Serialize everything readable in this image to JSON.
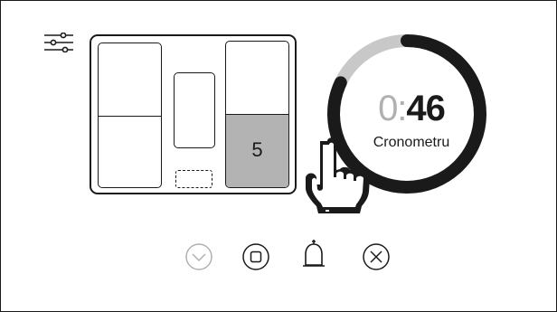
{
  "timer": {
    "minutes": "0:",
    "seconds": "46",
    "label": "Cronometru",
    "progress_fraction": 0.82
  },
  "hob": {
    "zones": [
      {
        "name": "left",
        "level": ""
      },
      {
        "name": "middle",
        "level": ""
      },
      {
        "name": "right",
        "level": "5"
      }
    ]
  },
  "controls": [
    {
      "name": "chevron-down-icon",
      "state": "disabled"
    },
    {
      "name": "stop-icon",
      "state": "enabled"
    },
    {
      "name": "bell-icon",
      "state": "enabled"
    },
    {
      "name": "close-icon",
      "state": "enabled"
    }
  ],
  "colors": {
    "ink": "#1a1a1a",
    "track": "#c8c8c8",
    "active_zone": "#b3b3b3",
    "disabled": "#b0b0b0"
  }
}
